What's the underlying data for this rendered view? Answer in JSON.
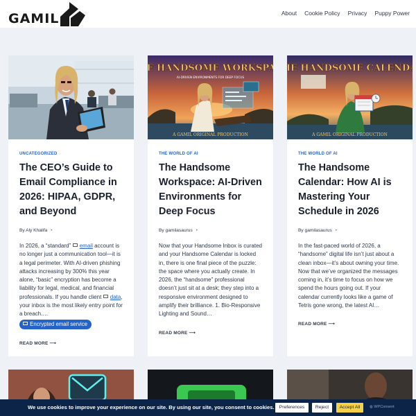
{
  "header": {
    "logo_text": "GAMIL",
    "nav": [
      "About",
      "Cookie Policy",
      "Privacy",
      "Puppy Power"
    ]
  },
  "cards": [
    {
      "image": "businessman-laptop-office",
      "category": "UNCATEGORIZED",
      "title": "The CEO’s Guide to Email Compliance in 2026: HIPAA, GDPR, and Beyond",
      "author_prefix": "By",
      "author": "Aly Khalifa",
      "excerpt": {
        "p1": "In 2026, a “standard” ",
        "link1": "email",
        "p2": " account is no longer just a communication tool—it is a legal perimeter. With AI-driven phishing attacks increasing by 300% this year alone, “basic” encryption has become a liability for legal, medical, and financial professionals. If you handle client ",
        "link2": "data",
        "p3": ", your inbox is the most likely entry point for a breach.…",
        "pill": "Encrypted email service"
      },
      "read_more": "READ MORE"
    },
    {
      "image": "handsome-workspace-poster",
      "image_title": "THE HANDSOME WORKSPACE",
      "image_subtitle": "AI-DRIVEN ENVIRONMENTS FOR DEEP FOCUS",
      "image_footer": "A GAMIL ORIGINAL PRODUCTION",
      "category": "THE WORLD OF AI",
      "title": "The Handsome Workspace: AI-Driven Environments for Deep Focus",
      "author_prefix": "By",
      "author": "gamilasaurus",
      "excerpt": "Now that your Handsome Inbox is curated and your Handsome Calendar is locked in, there is one final piece of the puzzle: the space where you actually create. In 2026, the “handsome” professional doesn’t just sit at a desk; they step into a responsive environment designed to amplify their brilliance. 1. Bio-Responsive Lighting and Sound…",
      "read_more": "READ MORE"
    },
    {
      "image": "handsome-calendar-poster",
      "image_title": "THE HANDSOME CALENDAR",
      "image_footer": "A GAMIL ORIGINAL PRODUCTION",
      "category": "THE WORLD OF AI",
      "title": "The Handsome Calendar: How AI is Mastering Your Schedule in 2026",
      "author_prefix": "By",
      "author": "gamilasaurus",
      "excerpt": "In the fast-paced world of 2026, a “handsome” digital life isn’t just about a clean inbox—it’s about owning your time. Now that we’ve organized the messages coming in, it’s time to focus on how we spend the hours going out. If your calendar currently looks like a game of Tetris gone wrong, the latest AI…",
      "read_more": "READ MORE"
    }
  ],
  "cookie": {
    "message": "We use cookies to improve your experience on our site. By using our site, you consent to cookies.",
    "preferences": "Preferences",
    "reject": "Reject",
    "accept": "Accept All",
    "brand": "WPConsent"
  },
  "colors": {
    "accent": "#2563c9",
    "cookie_bar": "#0b2447",
    "accept_button": "#f6d24a",
    "page_bg": "#eef1f5"
  }
}
